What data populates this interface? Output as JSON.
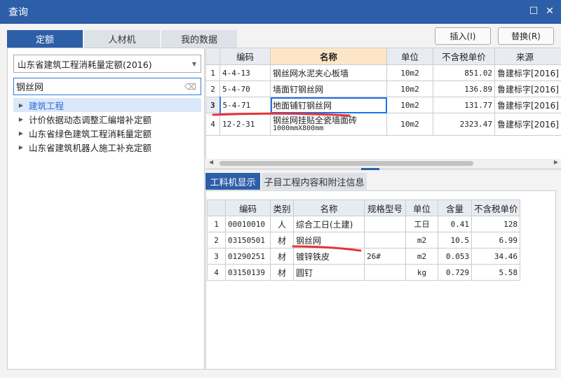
{
  "window": {
    "title": "查询"
  },
  "left_tabs": [
    "定额",
    "人材机",
    "我的数据"
  ],
  "buttons": {
    "insert": "插入(I)",
    "replace": "替换(R)"
  },
  "left": {
    "library_select": "山东省建筑工程消耗量定额(2016)",
    "search_value": "钢丝网",
    "tree": [
      "建筑工程",
      "计价依据动态调整汇编增补定额",
      "山东省绿色建筑工程消耗量定额",
      "山东省建筑机器人施工补充定额"
    ],
    "selected_index": 0
  },
  "top_table": {
    "headers": [
      "",
      "编码",
      "名称",
      "单位",
      "不含税单价",
      "来源"
    ],
    "rows": [
      [
        "1",
        "4-4-13",
        "钢丝网水泥夹心板墙",
        "",
        "10m2",
        "851.02",
        "鲁建标字[2016]"
      ],
      [
        "2",
        "5-4-70",
        "墙面钉钢丝网",
        "",
        "10m2",
        "136.89",
        "鲁建标字[2016]"
      ],
      [
        "3",
        "5-4-71",
        "地面铺钉钢丝网",
        "",
        "10m2",
        "131.77",
        "鲁建标字[2016]"
      ],
      [
        "4",
        "12-2-31",
        "钢丝网挂贴全瓷墙面砖",
        "1000mmX800mm",
        "10m2",
        "2323.47",
        "鲁建标字[2016]"
      ]
    ],
    "selected_row": 2
  },
  "bottom_tabs": [
    "工料机显示",
    "子目工程内容和附注信息"
  ],
  "bottom_table": {
    "headers": [
      "",
      "编码",
      "类别",
      "名称",
      "规格型号",
      "单位",
      "含量",
      "不含税单价"
    ],
    "rows": [
      [
        "1",
        "00010010",
        "人",
        "综合工日(土建)",
        "",
        "工日",
        "0.41",
        "128"
      ],
      [
        "2",
        "03150501",
        "材",
        "钢丝网",
        "",
        "m2",
        "10.5",
        "6.99"
      ],
      [
        "3",
        "01290251",
        "材",
        "镀锌铁皮",
        "26#",
        "m2",
        "0.053",
        "34.46"
      ],
      [
        "4",
        "03150139",
        "材",
        "圆钉",
        "",
        "kg",
        "0.729",
        "5.58"
      ]
    ]
  },
  "colors": {
    "accent": "#2d5ea8",
    "annotation": "#e8323a"
  }
}
